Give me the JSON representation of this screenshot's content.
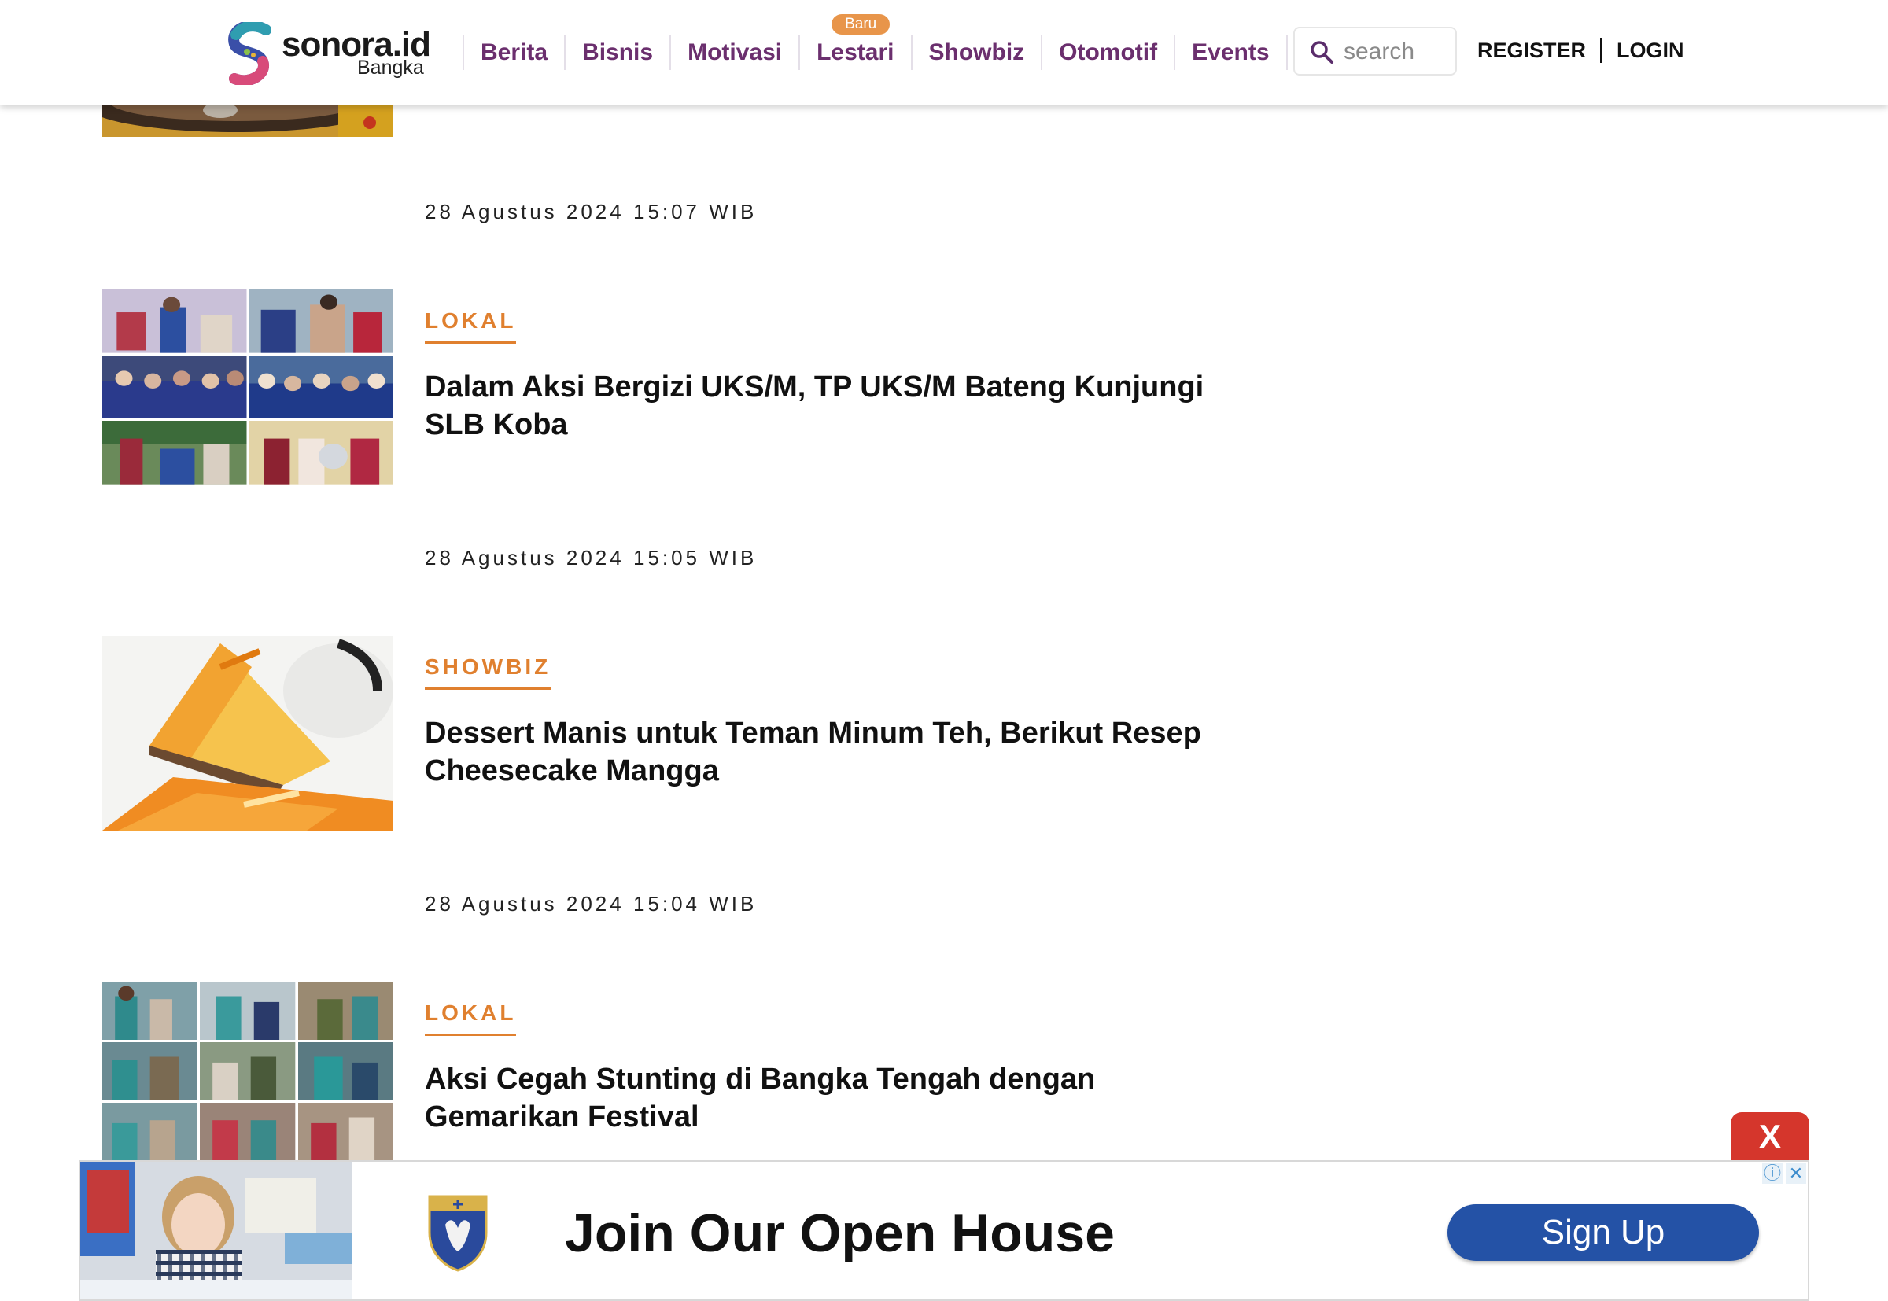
{
  "brand": {
    "name": "sonora.id",
    "region": "Bangka"
  },
  "nav": {
    "items": [
      {
        "label": "Berita"
      },
      {
        "label": "Bisnis"
      },
      {
        "label": "Motivasi"
      },
      {
        "label": "Lestari",
        "badge": "Baru"
      },
      {
        "label": "Showbiz"
      },
      {
        "label": "Otomotif"
      },
      {
        "label": "Events"
      }
    ]
  },
  "search": {
    "placeholder": "search"
  },
  "auth": {
    "register": "REGISTER",
    "login": "LOGIN"
  },
  "feed": {
    "top_date": "28 Agustus 2024 15:07 WIB",
    "articles": [
      {
        "category": "LOKAL",
        "title": "Dalam Aksi Bergizi UKS/M, TP UKS/M Bateng Kunjungi SLB Koba",
        "date": "28 Agustus 2024 15:05 WIB"
      },
      {
        "category": "SHOWBIZ",
        "title": "Dessert Manis untuk Teman Minum Teh, Berikut Resep Cheesecake Mangga",
        "date": "28 Agustus 2024 15:04 WIB"
      },
      {
        "category": "LOKAL",
        "title": "Aksi Cegah Stunting di Bangka Tengah dengan Gemarikan Festival"
      }
    ]
  },
  "ad": {
    "close_label": "X",
    "headline": "Join Our Open House",
    "cta": "Sign Up",
    "colors": {
      "cta": "#2452a6",
      "close": "#d5362c"
    }
  },
  "colors": {
    "nav": "#6b2f6e",
    "category": "#e0802f",
    "badge": "#e8954a"
  }
}
